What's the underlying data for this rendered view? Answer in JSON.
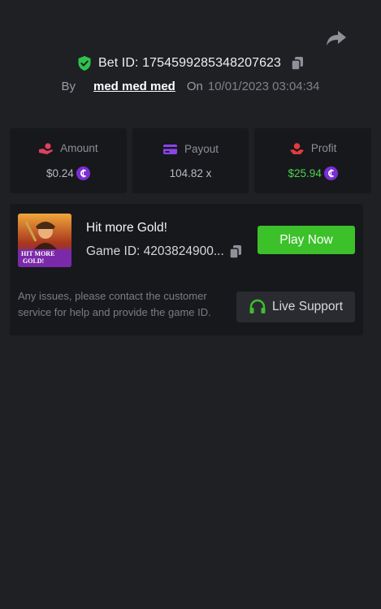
{
  "header": {
    "share_icon": "share-arrow-icon",
    "bet_id_label": "Bet ID: 1754599285348207623",
    "verified_icon": "shield-check-icon",
    "copy_icon": "copy-icon",
    "by_label": "By",
    "username": "med med med",
    "on_label": "On",
    "datetime": "10/01/2023 03:04:34"
  },
  "stats": {
    "amount": {
      "label": "Amount",
      "value": "$0.24",
      "icon": "hand-coin-icon",
      "coin_symbol": "₵"
    },
    "payout": {
      "label": "Payout",
      "value": "104.82 x",
      "icon": "card-icon"
    },
    "profit": {
      "label": "Profit",
      "value": "$25.94",
      "icon": "hand-coins-icon",
      "coin_symbol": "₵"
    }
  },
  "game": {
    "thumbnail_text_line1": "HIT MORE",
    "thumbnail_text_line2": "GOLD!",
    "title": "Hit more Gold!",
    "game_id": "Game ID: 4203824900...",
    "play_label": "Play Now",
    "help_text": "Any issues, please contact the customer service for help and provide the game ID.",
    "support_label": "Live Support",
    "support_icon": "headset-icon"
  },
  "colors": {
    "background": "#1f2024",
    "card": "#17181c",
    "accent_green": "#3cc12a",
    "profit_green": "#4bd24b",
    "coin_purple": "#7b2fd4",
    "amount_icon": "#e0405f",
    "payout_icon": "#8a45e8",
    "profit_icon": "#e23b3b"
  }
}
